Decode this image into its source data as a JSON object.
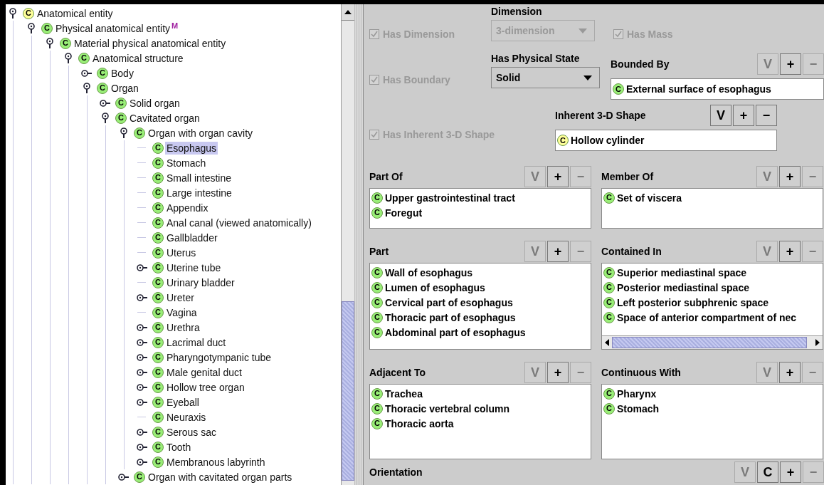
{
  "tree": {
    "nodes": [
      {
        "label": "Anatomical entity",
        "icon": "C",
        "color": "#ffff99",
        "kind": "branch",
        "expanded": true,
        "selected": false,
        "children": [
          {
            "label": "Physical anatomical entity",
            "badge": "M",
            "icon": "C",
            "color": "#99ee77",
            "kind": "branch",
            "expanded": true,
            "selected": false,
            "children": [
              {
                "label": "Material physical anatomical entity",
                "icon": "C",
                "color": "#99ee77",
                "kind": "branch",
                "expanded": true,
                "selected": false,
                "children": [
                  {
                    "label": "Anatomical structure",
                    "icon": "C",
                    "color": "#99ee77",
                    "kind": "branch",
                    "expanded": true,
                    "selected": false,
                    "children": [
                      {
                        "label": "Body",
                        "icon": "C",
                        "color": "#99ee77",
                        "kind": "branch",
                        "expanded": false,
                        "selected": false
                      },
                      {
                        "label": "Organ",
                        "icon": "C",
                        "color": "#99ee77",
                        "kind": "branch",
                        "expanded": true,
                        "selected": false,
                        "children": [
                          {
                            "label": "Solid organ",
                            "icon": "C",
                            "color": "#99ee77",
                            "kind": "branch",
                            "expanded": false,
                            "selected": false
                          },
                          {
                            "label": "Cavitated organ",
                            "icon": "C",
                            "color": "#99ee77",
                            "kind": "branch",
                            "expanded": true,
                            "selected": false,
                            "children": [
                              {
                                "label": "Organ with organ cavity",
                                "icon": "C",
                                "color": "#99ee77",
                                "kind": "branch",
                                "expanded": true,
                                "selected": false,
                                "children": [
                                  {
                                    "label": "Esophagus",
                                    "icon": "C",
                                    "color": "#99ee77",
                                    "kind": "leaf",
                                    "selected": true
                                  },
                                  {
                                    "label": "Stomach",
                                    "icon": "C",
                                    "color": "#99ee77",
                                    "kind": "leaf",
                                    "selected": false
                                  },
                                  {
                                    "label": "Small intestine",
                                    "icon": "C",
                                    "color": "#99ee77",
                                    "kind": "leaf",
                                    "selected": false
                                  },
                                  {
                                    "label": "Large intestine",
                                    "icon": "C",
                                    "color": "#99ee77",
                                    "kind": "leaf",
                                    "selected": false
                                  },
                                  {
                                    "label": "Appendix",
                                    "icon": "C",
                                    "color": "#99ee77",
                                    "kind": "leaf",
                                    "selected": false
                                  },
                                  {
                                    "label": "Anal canal (viewed anatomically)",
                                    "icon": "C",
                                    "color": "#99ee77",
                                    "kind": "leaf",
                                    "selected": false
                                  },
                                  {
                                    "label": "Gallbladder",
                                    "icon": "C",
                                    "color": "#99ee77",
                                    "kind": "leaf",
                                    "selected": false
                                  },
                                  {
                                    "label": "Uterus",
                                    "icon": "C",
                                    "color": "#99ee77",
                                    "kind": "leaf",
                                    "selected": false
                                  },
                                  {
                                    "label": "Uterine tube",
                                    "icon": "C",
                                    "color": "#99ee77",
                                    "kind": "branch",
                                    "expanded": false,
                                    "selected": false
                                  },
                                  {
                                    "label": "Urinary bladder",
                                    "icon": "C",
                                    "color": "#99ee77",
                                    "kind": "leaf",
                                    "selected": false
                                  },
                                  {
                                    "label": "Ureter",
                                    "icon": "C",
                                    "color": "#99ee77",
                                    "kind": "branch",
                                    "expanded": false,
                                    "selected": false
                                  },
                                  {
                                    "label": "Vagina",
                                    "icon": "C",
                                    "color": "#99ee77",
                                    "kind": "leaf",
                                    "selected": false
                                  },
                                  {
                                    "label": "Urethra",
                                    "icon": "C",
                                    "color": "#99ee77",
                                    "kind": "branch",
                                    "expanded": false,
                                    "selected": false
                                  },
                                  {
                                    "label": "Lacrimal duct",
                                    "icon": "C",
                                    "color": "#99ee77",
                                    "kind": "branch",
                                    "expanded": false,
                                    "selected": false
                                  },
                                  {
                                    "label": "Pharyngotympanic tube",
                                    "icon": "C",
                                    "color": "#99ee77",
                                    "kind": "branch",
                                    "expanded": false,
                                    "selected": false
                                  },
                                  {
                                    "label": "Male genital duct",
                                    "icon": "C",
                                    "color": "#99ee77",
                                    "kind": "branch",
                                    "expanded": false,
                                    "selected": false
                                  },
                                  {
                                    "label": "Hollow tree organ",
                                    "icon": "C",
                                    "color": "#99ee77",
                                    "kind": "branch",
                                    "expanded": false,
                                    "selected": false
                                  },
                                  {
                                    "label": "Eyeball",
                                    "icon": "C",
                                    "color": "#99ee77",
                                    "kind": "branch",
                                    "expanded": false,
                                    "selected": false
                                  },
                                  {
                                    "label": "Neuraxis",
                                    "icon": "C",
                                    "color": "#99ee77",
                                    "kind": "leaf",
                                    "selected": false
                                  },
                                  {
                                    "label": "Serous sac",
                                    "icon": "C",
                                    "color": "#99ee77",
                                    "kind": "branch",
                                    "expanded": false,
                                    "selected": false
                                  },
                                  {
                                    "label": "Tooth",
                                    "icon": "C",
                                    "color": "#99ee77",
                                    "kind": "branch",
                                    "expanded": false,
                                    "selected": false
                                  },
                                  {
                                    "label": "Membranous labyrinth",
                                    "icon": "C",
                                    "color": "#99ee77",
                                    "kind": "branch",
                                    "expanded": false,
                                    "selected": false
                                  }
                                ]
                              },
                              {
                                "label": "Organ with cavitated organ parts",
                                "icon": "C",
                                "color": "#99ee77",
                                "kind": "branch",
                                "expanded": false,
                                "selected": false
                              }
                            ]
                          }
                        ]
                      }
                    ]
                  }
                ]
              }
            ]
          }
        ]
      }
    ]
  },
  "top": {
    "has_dimension": {
      "label": "Has Dimension",
      "checked": true,
      "disabled": true
    },
    "dimension": {
      "label": "Dimension",
      "value": "3-dimension",
      "disabled": true
    },
    "has_mass": {
      "label": "Has Mass",
      "checked": true,
      "disabled": true
    },
    "has_boundary": {
      "label": "Has Boundary",
      "checked": true,
      "disabled": true
    },
    "physical_state": {
      "label": "Has Physical State",
      "value": "Solid",
      "disabled": false
    },
    "bounded_by": {
      "label": "Bounded By",
      "buttons": [
        {
          "label": "V",
          "disabled": true
        },
        {
          "label": "+",
          "disabled": false
        },
        {
          "label": "−",
          "disabled": true
        }
      ],
      "items": [
        {
          "label": "External surface of esophagus",
          "icon": "C",
          "color": "#99ee77"
        }
      ]
    },
    "has_inherent_shape": {
      "label": "Has Inherent 3-D Shape",
      "checked": true,
      "disabled": true
    },
    "inherent_shape": {
      "label": "Inherent 3-D Shape",
      "buttons": [
        {
          "label": "V",
          "disabled": false
        },
        {
          "label": "+",
          "disabled": false
        },
        {
          "label": "−",
          "disabled": false
        }
      ],
      "items": [
        {
          "label": "Hollow cylinder",
          "icon": "C",
          "color": "#ffff99"
        }
      ]
    }
  },
  "relations": [
    {
      "label": "Part Of",
      "hscroll": false,
      "buttons": [
        {
          "label": "V",
          "disabled": true
        },
        {
          "label": "+",
          "disabled": false
        },
        {
          "label": "−",
          "disabled": true
        }
      ],
      "items": [
        {
          "label": "Upper gastrointestinal tract",
          "icon": "C",
          "color": "#99ee77"
        },
        {
          "label": "Foregut",
          "icon": "C",
          "color": "#99ee77"
        }
      ]
    },
    {
      "label": "Member Of",
      "hscroll": false,
      "buttons": [
        {
          "label": "V",
          "disabled": true
        },
        {
          "label": "+",
          "disabled": false
        },
        {
          "label": "−",
          "disabled": true
        }
      ],
      "items": [
        {
          "label": "Set of viscera",
          "icon": "C",
          "color": "#99ee77"
        }
      ]
    },
    {
      "label": "Part",
      "hscroll": false,
      "buttons": [
        {
          "label": "V",
          "disabled": true
        },
        {
          "label": "+",
          "disabled": false
        },
        {
          "label": "−",
          "disabled": true
        }
      ],
      "items": [
        {
          "label": "Wall of esophagus",
          "icon": "C",
          "color": "#99ee77"
        },
        {
          "label": "Lumen of esophagus",
          "icon": "C",
          "color": "#99ee77"
        },
        {
          "label": "Cervical part of esophagus",
          "icon": "C",
          "color": "#99ee77"
        },
        {
          "label": "Thoracic part of esophagus",
          "icon": "C",
          "color": "#99ee77"
        },
        {
          "label": "Abdominal part of esophagus",
          "icon": "C",
          "color": "#99ee77"
        }
      ]
    },
    {
      "label": "Contained In",
      "hscroll": true,
      "buttons": [
        {
          "label": "V",
          "disabled": true
        },
        {
          "label": "+",
          "disabled": false
        },
        {
          "label": "−",
          "disabled": true
        }
      ],
      "items": [
        {
          "label": "Superior mediastinal space",
          "icon": "C",
          "color": "#99ee77"
        },
        {
          "label": "Posterior mediastinal space",
          "icon": "C",
          "color": "#99ee77"
        },
        {
          "label": "Left posterior subphrenic space",
          "icon": "C",
          "color": "#99ee77"
        },
        {
          "label": "Space of anterior compartment of nec",
          "icon": "C",
          "color": "#99ee77"
        }
      ]
    },
    {
      "label": "Adjacent To",
      "hscroll": false,
      "buttons": [
        {
          "label": "V",
          "disabled": true
        },
        {
          "label": "+",
          "disabled": false
        },
        {
          "label": "−",
          "disabled": true
        }
      ],
      "items": [
        {
          "label": "Trachea",
          "icon": "C",
          "color": "#99ee77"
        },
        {
          "label": "Thoracic vertebral column",
          "icon": "C",
          "color": "#99ee77"
        },
        {
          "label": "Thoracic aorta",
          "icon": "C",
          "color": "#99ee77"
        }
      ]
    },
    {
      "label": "Continuous With",
      "hscroll": false,
      "buttons": [
        {
          "label": "V",
          "disabled": true
        },
        {
          "label": "+",
          "disabled": false
        },
        {
          "label": "−",
          "disabled": true
        }
      ],
      "items": [
        {
          "label": "Pharynx",
          "icon": "C",
          "color": "#99ee77"
        },
        {
          "label": "Stomach",
          "icon": "C",
          "color": "#99ee77"
        }
      ]
    }
  ],
  "orientation": {
    "label": "Orientation",
    "buttons": [
      {
        "label": "V",
        "disabled": true
      },
      {
        "label": "C",
        "disabled": false
      },
      {
        "label": "+",
        "disabled": false
      },
      {
        "label": "−",
        "disabled": true
      }
    ]
  }
}
